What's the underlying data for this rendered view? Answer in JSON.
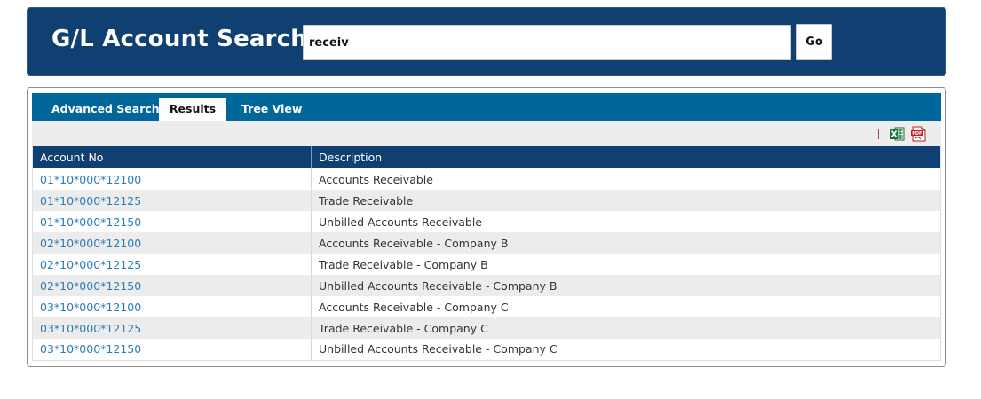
{
  "header": {
    "title": "G/L Account Search",
    "search_value": "receiv",
    "go_label": "Go"
  },
  "tabs": [
    {
      "label": "Advanced Search",
      "active": false
    },
    {
      "label": "Results",
      "active": true
    },
    {
      "label": "Tree View",
      "active": false
    }
  ],
  "toolbar": {
    "export_excel_icon": "excel-icon",
    "export_pdf_icon": "pdf-icon"
  },
  "table": {
    "columns": [
      "Account No",
      "Description"
    ],
    "rows": [
      [
        "01*10*000*12100",
        "Accounts Receivable"
      ],
      [
        "01*10*000*12125",
        "Trade Receivable"
      ],
      [
        "01*10*000*12150",
        "Unbilled Accounts Receivable"
      ],
      [
        "02*10*000*12100",
        "Accounts Receivable - Company B"
      ],
      [
        "02*10*000*12125",
        "Trade Receivable - Company B"
      ],
      [
        "02*10*000*12150",
        "Unbilled Accounts Receivable - Company B"
      ],
      [
        "03*10*000*12100",
        "Accounts Receivable - Company C"
      ],
      [
        "03*10*000*12125",
        "Trade Receivable - Company C"
      ],
      [
        "03*10*000*12150",
        "Unbilled Accounts Receivable - Company C"
      ]
    ]
  },
  "colors": {
    "header_bg": "#0f4071",
    "tabbar_bg": "#00679b",
    "link": "#2a7db7",
    "row_alt": "#ececec"
  }
}
